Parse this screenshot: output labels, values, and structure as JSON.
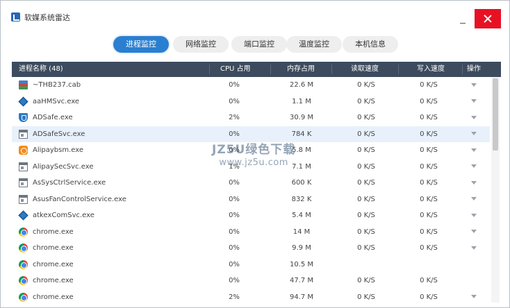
{
  "window": {
    "title": "软媒系统雷达",
    "icon": "app-logo-icon",
    "controls": [
      "minimize-icon",
      "close-icon"
    ]
  },
  "tabs": [
    {
      "label": "进程监控",
      "active": true
    },
    {
      "label": "网络监控",
      "active": false
    },
    {
      "label": "端口监控",
      "active": false
    },
    {
      "label": "温度监控",
      "active": false
    },
    {
      "label": "本机信息",
      "active": false
    }
  ],
  "table": {
    "columns": {
      "name": "进程名称 (48)",
      "cpu": "CPU 占用",
      "mem": "内存占用",
      "read": "读取速度",
      "write": "写入速度",
      "op": "操作"
    },
    "rows": [
      {
        "icon": "cab-icon",
        "name": "~THB237.cab",
        "cpu": "0%",
        "mem": "22.6 M",
        "read": "0 K/S",
        "write": "0 K/S",
        "op": true
      },
      {
        "icon": "diamond-icon",
        "name": "aaHMSvc.exe",
        "cpu": "0%",
        "mem": "1.1 M",
        "read": "0 K/S",
        "write": "0 K/S",
        "op": true
      },
      {
        "icon": "shield-icon",
        "name": "ADSafe.exe",
        "cpu": "2%",
        "mem": "30.9 M",
        "read": "0 K/S",
        "write": "0 K/S",
        "op": true
      },
      {
        "icon": "window-icon",
        "name": "ADSafeSvc.exe",
        "cpu": "0%",
        "mem": "784 K",
        "read": "0 K/S",
        "write": "0 K/S",
        "op": true
      },
      {
        "icon": "alipay-icon",
        "name": "Alipaybsm.exe",
        "cpu": "0%",
        "mem": "5.8 M",
        "read": "0 K/S",
        "write": "0 K/S",
        "op": true
      },
      {
        "icon": "window-icon",
        "name": "AlipaySecSvc.exe",
        "cpu": "1%",
        "mem": "7.1 M",
        "read": "0 K/S",
        "write": "0 K/S",
        "op": true
      },
      {
        "icon": "window-icon",
        "name": "AsSysCtrlService.exe",
        "cpu": "0%",
        "mem": "600 K",
        "read": "0 K/S",
        "write": "0 K/S",
        "op": true
      },
      {
        "icon": "window-icon",
        "name": "AsusFanControlService.exe",
        "cpu": "0%",
        "mem": "832 K",
        "read": "0 K/S",
        "write": "0 K/S",
        "op": true
      },
      {
        "icon": "diamond-icon",
        "name": "atkexComSvc.exe",
        "cpu": "0%",
        "mem": "5.4 M",
        "read": "0 K/S",
        "write": "0 K/S",
        "op": true
      },
      {
        "icon": "chrome-icon",
        "name": "chrome.exe",
        "cpu": "0%",
        "mem": "14 M",
        "read": "0 K/S",
        "write": "0 K/S",
        "op": true
      },
      {
        "icon": "chrome-icon",
        "name": "chrome.exe",
        "cpu": "0%",
        "mem": "9.9 M",
        "read": "0 K/S",
        "write": "0 K/S",
        "op": true
      },
      {
        "icon": "chrome-icon",
        "name": "chrome.exe",
        "cpu": "0%",
        "mem": "10.5 M",
        "read": "",
        "write": "",
        "op": false
      },
      {
        "icon": "chrome-icon",
        "name": "chrome.exe",
        "cpu": "0%",
        "mem": "47.7 M",
        "read": "0 K/S",
        "write": "0 K/S",
        "op": false
      },
      {
        "icon": "chrome-icon",
        "name": "chrome.exe",
        "cpu": "2%",
        "mem": "94.7 M",
        "read": "0 K/S",
        "write": "0 K/S",
        "op": true
      }
    ],
    "selected_row": 3
  },
  "watermark": {
    "main": "JZ5U绿色下载",
    "sub": "www.jz5u.com"
  }
}
